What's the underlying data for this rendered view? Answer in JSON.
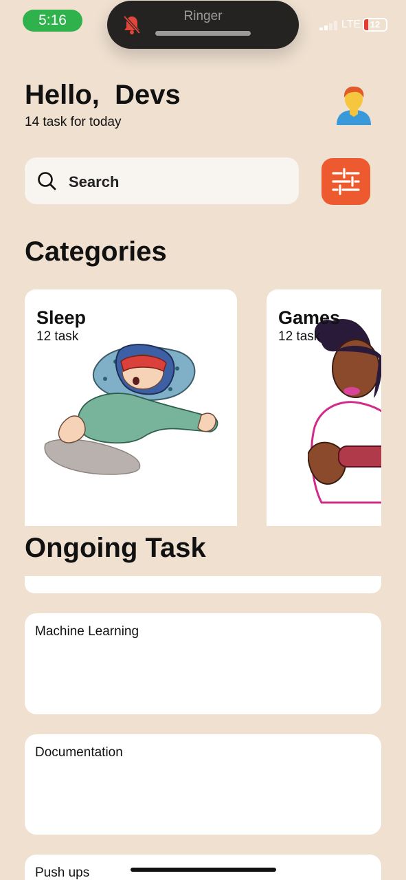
{
  "status_bar": {
    "time": "5:16",
    "island_label": "Ringer",
    "network": "LTE",
    "battery": "12"
  },
  "header": {
    "greeting": "Hello,  Devs",
    "subtitle": "14 task for today"
  },
  "search": {
    "placeholder": "Search"
  },
  "sections": {
    "categories_title": "Categories",
    "ongoing_title": "Ongoing Task"
  },
  "categories": [
    {
      "name": "Sleep",
      "count": "12 task"
    },
    {
      "name": "Games",
      "count": "12 task"
    }
  ],
  "tasks": [
    {
      "label": "Machine Learning"
    },
    {
      "label": "Documentation"
    },
    {
      "label": "Push ups"
    }
  ],
  "colors": {
    "background": "#efe0d0",
    "accent": "#ee5a2f",
    "time_pill": "#2fb24c",
    "card": "#ffffff"
  },
  "icons": [
    "bell-slash-icon",
    "search-icon",
    "sliders-icon",
    "avatar-icon",
    "signal-icon",
    "battery-icon"
  ]
}
